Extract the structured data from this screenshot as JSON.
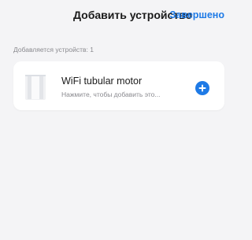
{
  "header": {
    "title": "Добавить устройство",
    "done_label": "Завершено"
  },
  "section": {
    "label": "Добавляется устройств: 1"
  },
  "device": {
    "name": "WiFi tubular motor",
    "hint": "Нажмите, чтобы добавить это...",
    "thumbnail_icon": "tubular-motor-device-icon",
    "action_icon": "plus-circle-icon"
  },
  "colors": {
    "accent": "#1e7ae6",
    "background": "#f4f4f6",
    "card": "#ffffff"
  }
}
